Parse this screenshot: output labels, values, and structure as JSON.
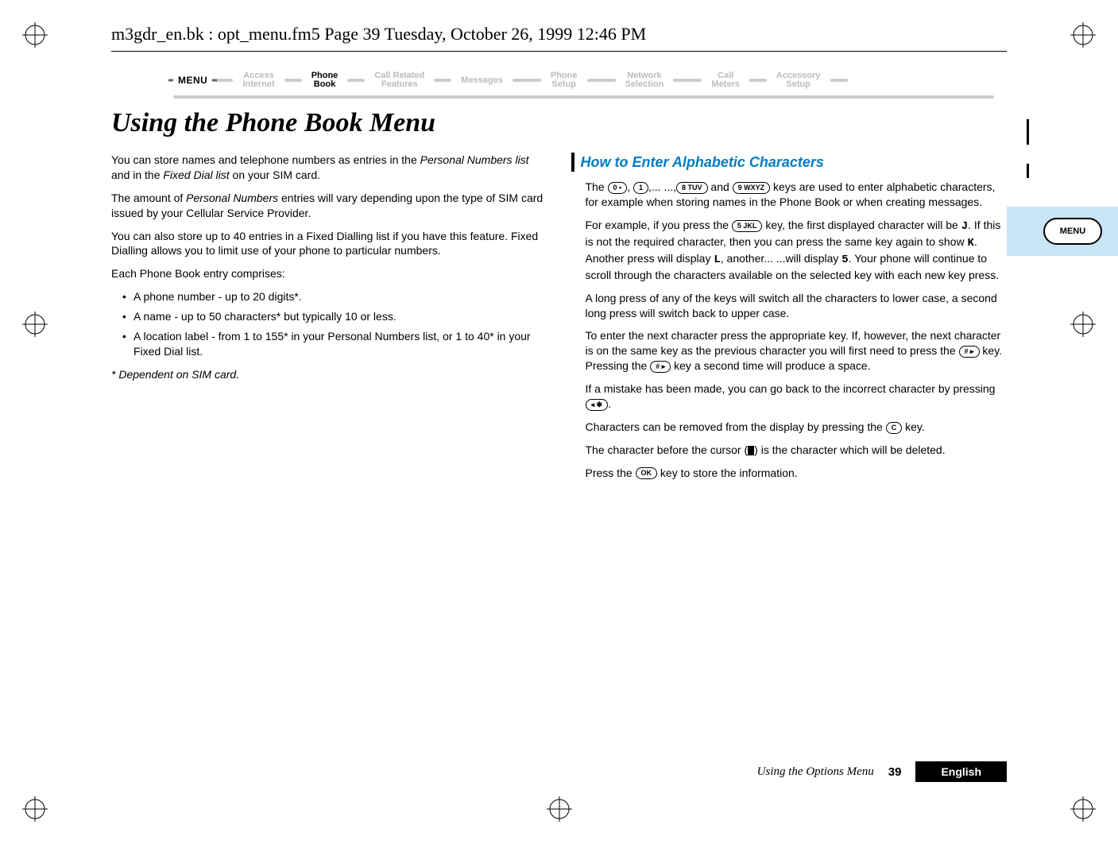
{
  "header_line": "m3gdr_en.bk : opt_menu.fm5  Page 39  Tuesday, October 26, 1999  12:46 PM",
  "menu": {
    "key_label": "MENU",
    "items": [
      {
        "line1": "Access",
        "line2": "Internet",
        "active": false
      },
      {
        "line1": "Phone",
        "line2": "Book",
        "active": true
      },
      {
        "line1": "Call Related",
        "line2": "Features",
        "active": false
      },
      {
        "line1": "Messages",
        "line2": "",
        "active": false
      },
      {
        "line1": "Phone",
        "line2": "Setup",
        "active": false
      },
      {
        "line1": "Network",
        "line2": "Selection",
        "active": false
      },
      {
        "line1": "Call",
        "line2": "Meters",
        "active": false
      },
      {
        "line1": "Accessory",
        "line2": "Setup",
        "active": false
      }
    ]
  },
  "page_title": "Using the Phone Book Menu",
  "side_tab": "MENU",
  "left": {
    "p1a": "You can store names and telephone numbers as entries in the ",
    "p1b": "Personal Numbers list",
    "p1c": " and in the ",
    "p1d": "Fixed Dial list",
    "p1e": " on your SIM card.",
    "p2a": "The amount of ",
    "p2b": "Personal Numbers",
    "p2c": " entries will vary depending upon the type of SIM card issued by your Cellular Service Provider.",
    "p3": "You can also store up to 40 entries in a Fixed Dialling list if you have this feature. Fixed Dialling allows you to limit use of your phone to particular numbers.",
    "p4": "Each Phone Book entry comprises:",
    "b1": "A phone number - up to 20 digits*.",
    "b2": "A name - up to 50 characters* but typically 10 or less.",
    "b3": "A location label - from 1 to 155* in your Personal Numbers list, or 1 to 40* in your Fixed Dial list.",
    "footnote": "* Dependent on SIM card."
  },
  "right": {
    "heading": "How to Enter Alphabetic Characters",
    "p1a": "The ",
    "p1b": ", ",
    "p1c": ",... ...,",
    "p1d": " and ",
    "p1e": " keys are used to enter alphabetic characters, for example when storing names in the Phone Book or when creating messages.",
    "p2a": "For example, if you press the ",
    "p2b": " key, the first displayed character will be ",
    "p2c": ". If this is not the required character, then you can press the same key again to show ",
    "p2d": ". Another press will display ",
    "p2e": ", another...  ...will display ",
    "p2f": ". Your phone will continue to scroll through the characters available on the selected key with each new key press.",
    "p3": "A long press of any of the keys will switch all the characters to lower case, a second long press will switch back to upper case.",
    "p4a": "To enter the next character press the appropriate key. If, however, the next character is on the same key as the previous character you will first need to press the ",
    "p4b": " key. Pressing the ",
    "p4c": " key a second time will produce a space.",
    "p5a": "If a mistake has been made, you can go back to the incorrect character by pressing ",
    "p5b": ".",
    "p6a": "Characters can be removed from the display by pressing the ",
    "p6b": " key.",
    "p7a": "The character before the cursor (",
    "p7b": ") is the character which will be deleted.",
    "p8a": "Press the ",
    "p8b": " key to store the information.",
    "keys": {
      "zero": "0 •",
      "one": "1",
      "eight": "8 TUV",
      "nine": "9 WXYZ",
      "five": "5 JKL",
      "hash": "# ▸",
      "star": "◂ ✱",
      "c": "C",
      "ok": "OK"
    },
    "lcd": {
      "j": "J",
      "k": "K",
      "l": "L",
      "five": "5"
    }
  },
  "footer": {
    "title": "Using the Options Menu",
    "page": "39",
    "language": "English"
  }
}
